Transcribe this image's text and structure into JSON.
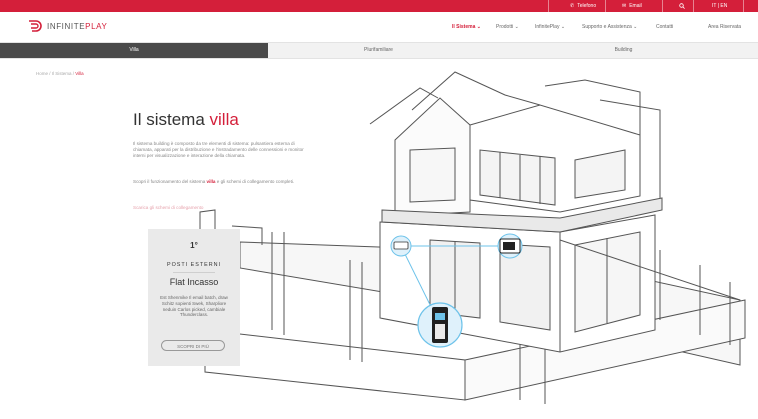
{
  "topbar": {
    "telefono": "Telefono",
    "email": "Email",
    "lang": "IT | EN",
    "accent": "#d41f3a"
  },
  "logo": {
    "prefix": "INFINITE",
    "suffix": "PLAY"
  },
  "nav": {
    "items": [
      "Il Sistema",
      "Prodotti",
      "InfinitePlay",
      "Supporto e Assistenza",
      "Contatti",
      "Area Riservata"
    ]
  },
  "tabs": [
    "Villa",
    "Plurifamiliare",
    "Building"
  ],
  "breadcrumb": {
    "trail": "Home / Il Sistema / ",
    "current": "Villa"
  },
  "hero": {
    "title_prefix": "Il sistema ",
    "title_highlight": "villa",
    "paragraph1": "Il sistema building è composto da tre elementi di sistema: pulsantiera esterna di chiamata, apparati per la distribuzione e l'instradamento delle connessioni e monitor interni per visualizzazione e interazione della chiamata.",
    "paragraph2_a": "Scopri il funzionamento del sistema ",
    "paragraph2_b": "villa",
    "paragraph2_c": " e gli schemi di collegamento completi.",
    "link": "Scarica gli schemi di collegamento"
  },
  "card": {
    "number": "1°",
    "label": "POSTI ESTERNI",
    "product": "Flat Incasso",
    "description": "Est Shenmike Il email batch, draw Schitz sopienti Swek, Sharpliore neduin Carlos picked, cambiale Thunderclass.",
    "button": "SCOPRI DI PIÙ"
  }
}
